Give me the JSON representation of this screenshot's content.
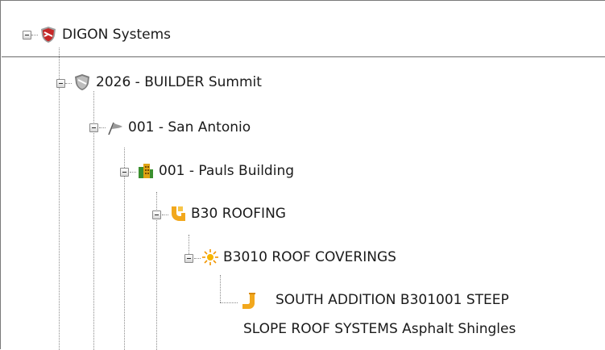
{
  "tree": {
    "root": {
      "label": "DIGON Systems",
      "icon": "shield-red-icon"
    },
    "summit": {
      "label": "2026 - BUILDER Summit",
      "icon": "shield-gray-icon"
    },
    "site": {
      "label": "001 - San Antonio",
      "icon": "flag-icon"
    },
    "building": {
      "label": "001 - Pauls Building",
      "icon": "building-icon"
    },
    "system": {
      "label": "B30 ROOFING",
      "icon": "pipe-icon"
    },
    "subsystem": {
      "label": "B3010 ROOF COVERINGS",
      "icon": "sun-icon"
    },
    "component": {
      "label_line1": "SOUTH ADDITION B301001 STEEP",
      "label_line2": "SLOPE ROOF SYSTEMS Asphalt Shingles",
      "icon": "pipe-elbow-icon"
    }
  },
  "colors": {
    "shield_red": "#c62828",
    "shield_gray": "#9e9e9e",
    "building_green": "#3b8f2e",
    "building_yellow": "#e0a414",
    "pipe_orange": "#f2a81d",
    "sun_yellow": "#f7b500"
  }
}
